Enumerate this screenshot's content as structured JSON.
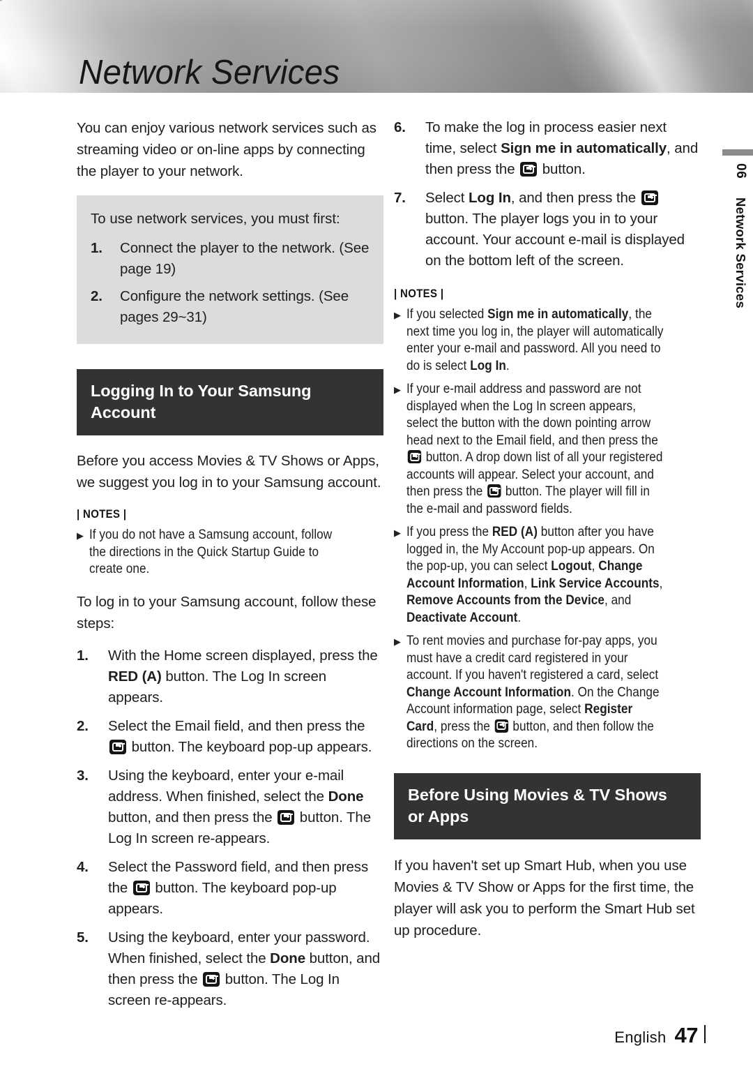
{
  "header": {
    "title": "Network Services"
  },
  "side_tab": {
    "chapter_number": "06",
    "chapter_name": "Network Services"
  },
  "left_column": {
    "intro_paragraph": "You can enjoy various network services such as streaming video or on-line apps by connecting the player to your network.",
    "callout": {
      "intro": "To use network services, you must first:",
      "steps": [
        {
          "num": "1.",
          "text": "Connect the player to the network. (See page 19)"
        },
        {
          "num": "2.",
          "text": "Configure the network settings. (See pages 29~31)"
        }
      ]
    },
    "section_header": "Logging In to Your Samsung Account",
    "section_intro": "Before you access Movies & TV Shows or Apps, we suggest you log in to your Samsung account.",
    "notes_label": "| NOTES |",
    "notes": [
      "If you do not have a Samsung account, follow the directions in the Quick Startup Guide to create one."
    ],
    "steps_intro": "To log in to your Samsung account, follow these steps:",
    "steps": [
      {
        "num": "1.",
        "text_a": "With the Home screen displayed, press the ",
        "bold_a": "RED (A)",
        "text_b": " button. The Log In screen appears."
      },
      {
        "num": "2.",
        "text_a": "Select the Email field, and then press the ",
        "text_b": " button. The keyboard pop-up appears."
      },
      {
        "num": "3.",
        "text_a": "Using the keyboard, enter your e-mail address. When finished, select the ",
        "bold_a": "Done",
        "text_b": " button, and then press the ",
        "text_c": " button. The Log In screen re-appears."
      },
      {
        "num": "4.",
        "text_a": "Select the Password field, and then press the ",
        "text_b": " button. The keyboard pop-up appears."
      },
      {
        "num": "5.",
        "text_a": "Using the keyboard, enter your password. When finished, select the ",
        "bold_a": "Done",
        "text_b": " button, and then press the ",
        "text_c": " button. The Log In screen re-appears."
      }
    ]
  },
  "right_column": {
    "steps": [
      {
        "num": "6.",
        "text_a": "To make the log in process easier next time, select ",
        "bold_a": "Sign me in automatically",
        "text_b": ", and then press the ",
        "text_c": " button."
      },
      {
        "num": "7.",
        "text_a": "Select ",
        "bold_a": "Log In",
        "text_b": ", and then press the ",
        "text_c": " button. The player logs you in to your account. Your account e-mail is displayed on the bottom left of the screen."
      }
    ],
    "notes_label": "| NOTES |",
    "notes": [
      {
        "parts": [
          "If you selected ",
          "Sign me in automatically",
          ", the next time you log in, the player will automatically enter your e-mail and password. All you need to do is select ",
          "Log In",
          "."
        ]
      },
      {
        "parts": [
          "If your e-mail address and password are not displayed when the Log In screen appears, select the button with the down pointing arrow head next to the Email field, and then press the ",
          "[ENTER]",
          " button. A drop down list of all your registered accounts will appear. Select your account, and then press the ",
          "[ENTER]",
          " button. The player will fill in the e-mail and password fields."
        ]
      },
      {
        "parts": [
          "If you press the ",
          "RED (A)",
          " button after you have logged in, the My Account pop-up appears. On the pop-up, you can select ",
          "Logout",
          ", ",
          "Change Account Information",
          ", ",
          "Link Service Accounts",
          ", ",
          "Remove Accounts from the Device",
          ", and ",
          "Deactivate Account",
          "."
        ]
      },
      {
        "parts": [
          "To rent movies and purchase for-pay apps, you must have a credit card registered in your account. If you haven't registered a card, select ",
          "Change Account Information",
          ". On the Change Account information page, select ",
          "Register Card",
          ", press the ",
          "[ENTER]",
          " button, and then follow the directions on the screen."
        ]
      }
    ],
    "section_header": "Before Using Movies & TV Shows or Apps",
    "section_body": "If you haven't set up Smart Hub, when you use Movies & TV Show or Apps for the first time, the player will ask you to perform the Smart Hub set up procedure."
  },
  "footer": {
    "language": "English",
    "page_number": "47"
  },
  "icons": {
    "enter_button": "enter-button-icon",
    "note_bullet": "▶"
  },
  "colors": {
    "section_header_bg": "#333333",
    "callout_bg": "#dcdcdc",
    "text": "#1e1e1e",
    "side_bar": "#8b8b8b"
  }
}
